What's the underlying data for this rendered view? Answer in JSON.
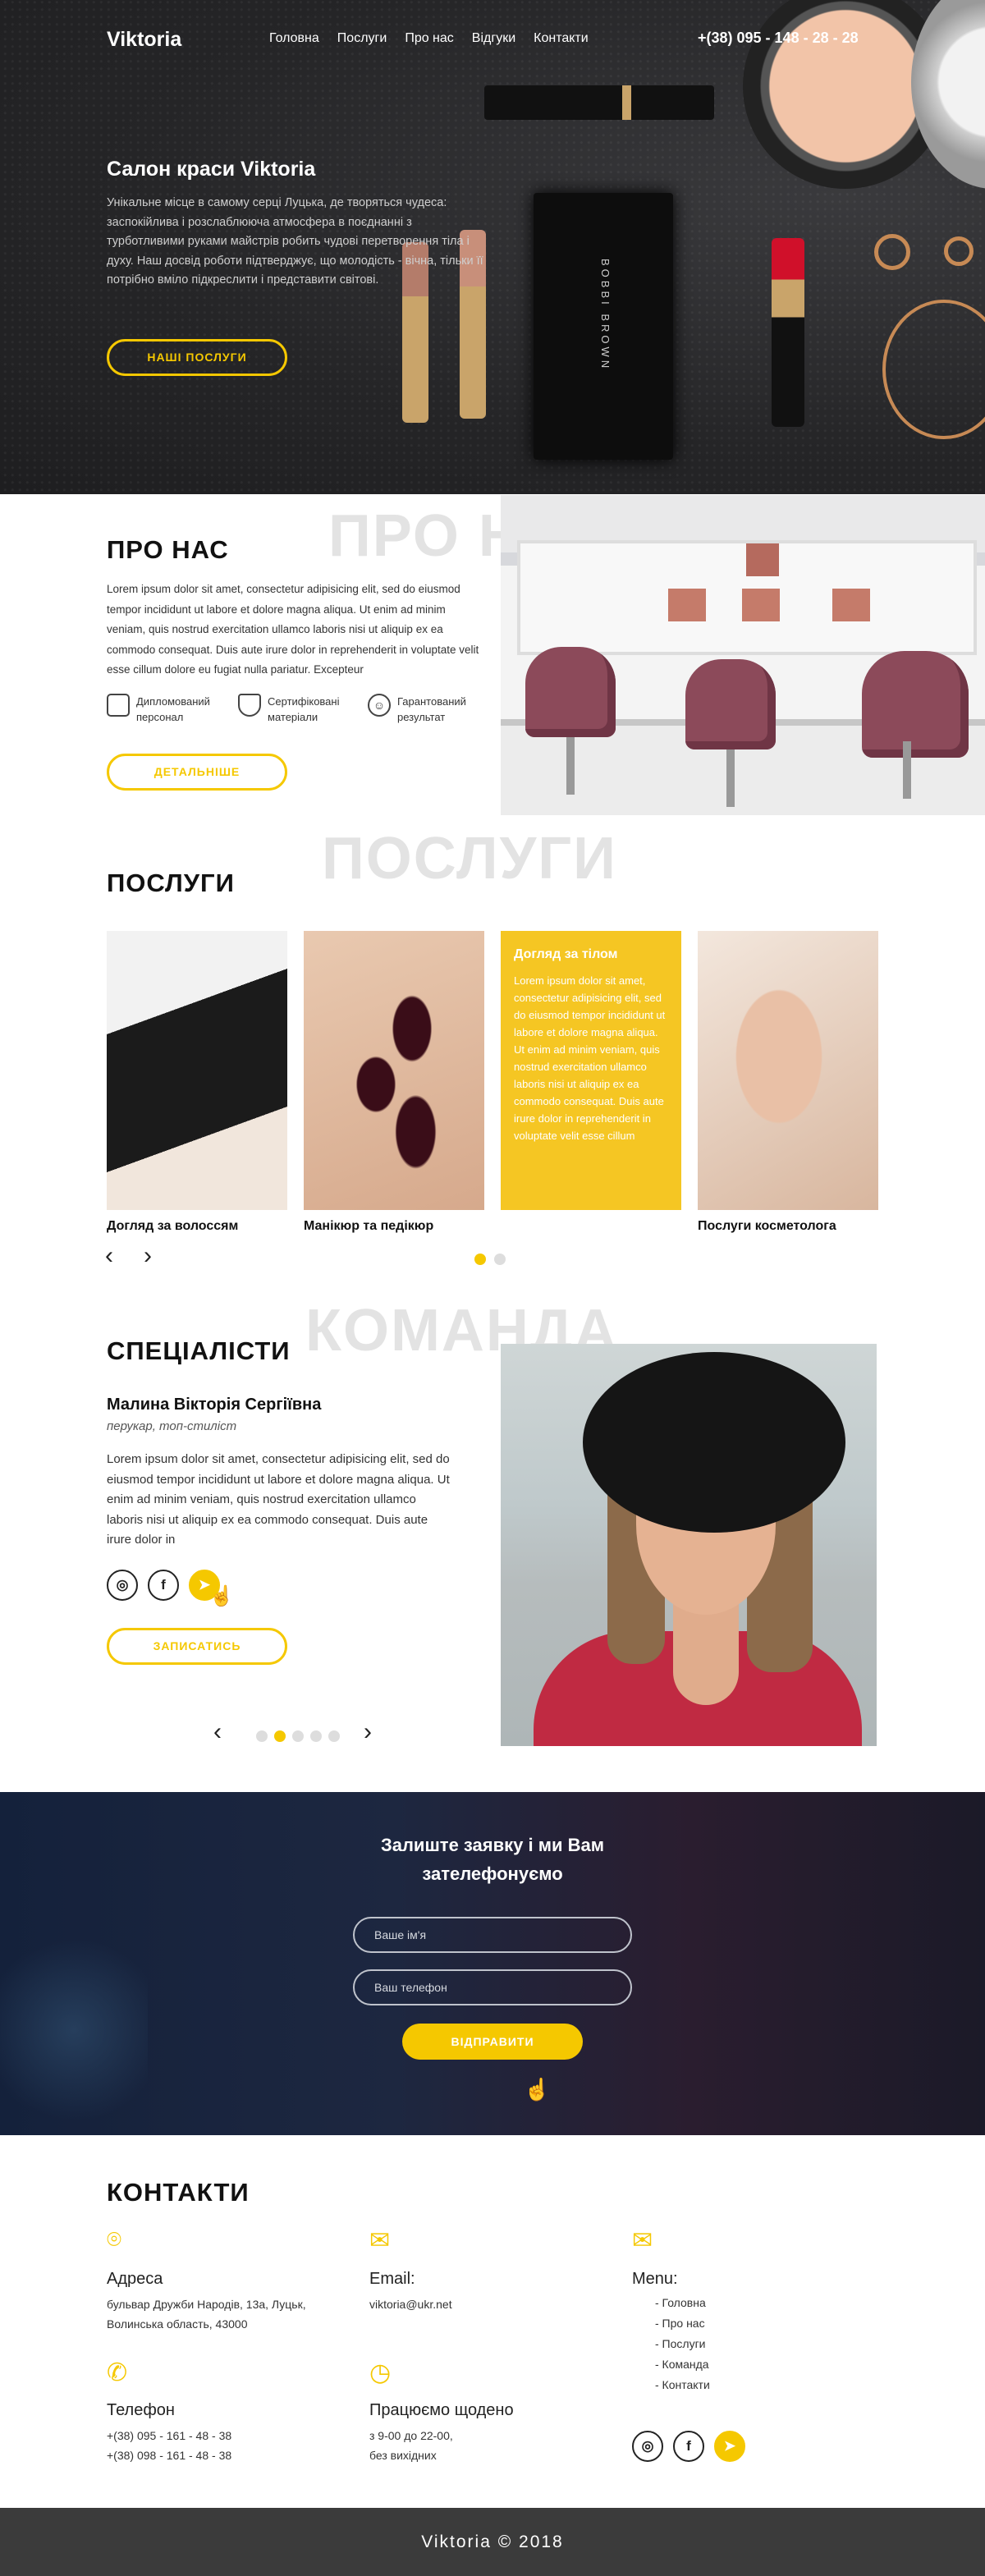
{
  "brand": "Viktoria",
  "nav": [
    "Головна",
    "Послуги",
    "Про нас",
    "Відгуки",
    "Контакти"
  ],
  "phone": "+(38) 095 - 148 - 28 - 28",
  "hero": {
    "title": "Салон краси Viktoria",
    "text": "Унікальне місце в самому серці Луцька, де творяться чудеса: заспокійлива і розслаблююча атмосфера в поєднанні з турботливими руками майстрів робить чудові перетворення тіла і духу. Наш досвід роботи підтверджує, що молодість - вічна, тільки її потрібно вміло підкреслити і представити світові.",
    "button": "НАШІ ПОСЛУГИ",
    "palette_text": "BOBBI BROWN"
  },
  "about": {
    "title": "ПРО НАС",
    "ghost": "ПРО НАС",
    "text": "Lorem ipsum dolor sit amet, consectetur adipisicing elit, sed do eius­mod tempor incididunt ut labore et dolore magna aliqua. Ut enim ad minim veniam, quis nostrud exercitation ullamco laboris nisi ut aliquip ex ea commodo consequat. Duis aute irure dolor in reprehenderit in voluptate velit esse cillum dolore eu fugiat nulla pariatur. Excepteur",
    "features": [
      {
        "icon": "certificate-icon",
        "label": "Дипломований персонал"
      },
      {
        "icon": "flask-icon",
        "label": "Сертифіковані матеріали"
      },
      {
        "icon": "smile-icon",
        "label": "Гарантований результат"
      }
    ],
    "button": "ДЕТАЛЬНІШЕ"
  },
  "services": {
    "title": "ПОСЛУГИ",
    "ghost": "ПОСЛУГИ",
    "items": [
      {
        "label": "Догляд за волоссям"
      },
      {
        "label": "Манікюр та педікюр"
      },
      {
        "label": "Догляд за тілом",
        "text": "Lorem ipsum dolor sit amet, consectetur adipisicing elit, sed do eiusmod tempor incididunt ut labore et dolore magna aliqua. Ut enim ad minim veniam, quis nostrud exercitation ullamco laboris nisi ut aliquip ex ea commodo consequat. Duis aute irure dolor in reprehenderit in voluptate velit esse cillum"
      },
      {
        "label": "Послуги косметолога"
      }
    ],
    "prev": "‹",
    "next": "›",
    "page_dots": 2,
    "active_dot": 1
  },
  "team": {
    "title": "СПЕЦІАЛІСТИ",
    "ghost": "КОМАНДА",
    "name": "Малина Вікторія Сергіївна",
    "role": "перукар, топ-стиліст",
    "text": "Lorem ipsum dolor sit amet, consectetur adipisicing elit, sed do eiusmod tempor incididunt ut labore et dolore magna aliqua. Ut enim ad minim veniam, quis nostrud exercitation ullamco laboris nisi ut aliquip ex ea commodo consequat. Duis aute irure dolor in",
    "button": "ЗАПИСАТИСЬ",
    "prev": "‹",
    "next": "›",
    "page_dots": 5,
    "active_dot": 2
  },
  "form": {
    "title_line1": "Залиште заявку і ми Вам",
    "title_line2": "зателефонуємо",
    "name_placeholder": "Ваше ім'я",
    "phone_placeholder": "Ваш телефон",
    "submit": "ВІДПРАВИТИ"
  },
  "contacts": {
    "title": "КОНТАКТИ",
    "address_label": "Адреса",
    "address_line1": "бульвар Дружби Народів, 13а, Луцьк,",
    "address_line2": "Волинська область, 43000",
    "email_label": "Email:",
    "email": "viktoria@ukr.net",
    "menu_label": "Menu:",
    "menu": [
      "- Головна",
      "- Про нас",
      "- Послуги",
      "- Команда",
      "- Контакти"
    ],
    "phone_label": "Телефон",
    "phone1": "+(38) 095 - 161 - 48 - 38",
    "phone2": "+(38) 098 - 161 - 48 - 38",
    "hours_label": "Працюємо щодено",
    "hours_line1": "з 9-00 до 22-00,",
    "hours_line2": "без вихідних"
  },
  "footer": "Viktoria © 2018",
  "colors": {
    "accent": "#f5c800",
    "dark": "#2b2b2d",
    "footer": "#3b3b3b"
  }
}
